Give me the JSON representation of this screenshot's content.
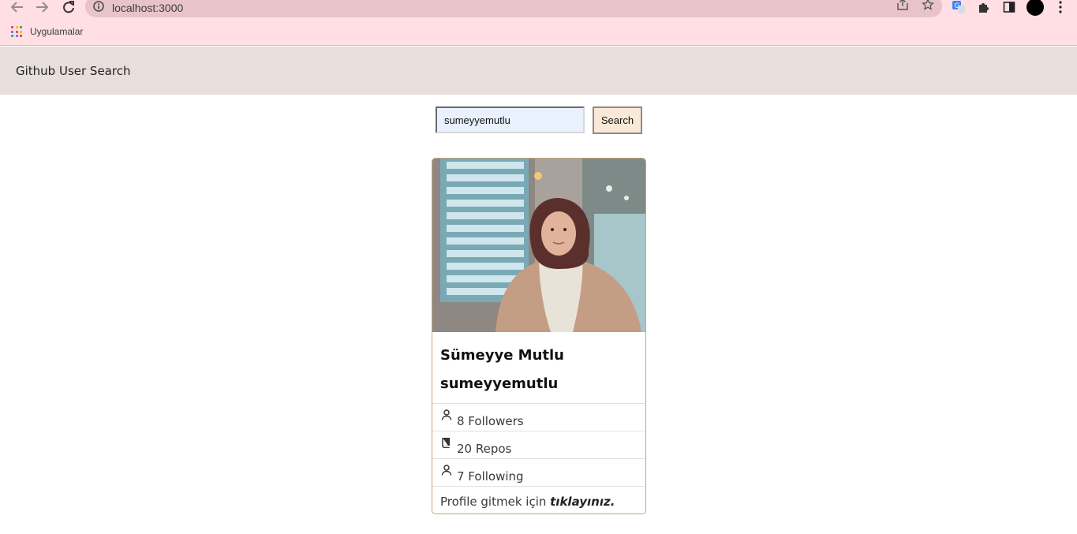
{
  "browser": {
    "url": "localhost:3000",
    "bookmarks": {
      "apps_label": "Uygulamalar"
    }
  },
  "app": {
    "brand": "Github User Search",
    "search": {
      "value": "sumeyyemutlu",
      "button_label": "Search"
    },
    "card": {
      "name": "Sümeyye Mutlu",
      "login": "sumeyyemutlu",
      "followers": "8 Followers",
      "repos": "20 Repos",
      "following": "7 Following",
      "profile_text": "Profile gitmek için ",
      "profile_link": "tıklayınız."
    }
  },
  "colors": {
    "chrome_bg": "#ffdfe4",
    "navbar_bg": "#e8dfdd",
    "card_border": "#c7a77a",
    "search_bg": "#e9f0fe",
    "button_bg": "#fbe9d8"
  },
  "icons": [
    "back-arrow-icon",
    "forward-arrow-icon",
    "reload-icon",
    "info-icon",
    "share-icon",
    "star-icon",
    "translate-icon",
    "puzzle-icon",
    "sidepanel-icon",
    "menu-dots-icon",
    "apps-grid-icon",
    "person-icon",
    "book-icon"
  ]
}
